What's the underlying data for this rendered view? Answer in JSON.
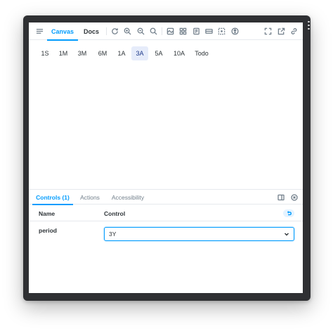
{
  "toolbar": {
    "tabs": [
      {
        "label": "Canvas",
        "active": true
      },
      {
        "label": "Docs",
        "active": false
      }
    ],
    "icons": [
      "sidebar-toggle-icon",
      "remount-icon",
      "zoom-in-icon",
      "zoom-out-icon",
      "zoom-reset-icon",
      "background-icon",
      "grid-icon",
      "viewport-icon",
      "measure-icon",
      "outline-icon",
      "accessibility-icon",
      "fullscreen-icon",
      "open-new-tab-icon",
      "copy-link-icon"
    ]
  },
  "canvas": {
    "periods": [
      {
        "label": "1S"
      },
      {
        "label": "1M"
      },
      {
        "label": "3M"
      },
      {
        "label": "6M"
      },
      {
        "label": "1A"
      },
      {
        "label": "3A",
        "selected": true
      },
      {
        "label": "5A"
      },
      {
        "label": "10A"
      },
      {
        "label": "Todo"
      }
    ]
  },
  "addons": {
    "tabs": [
      {
        "label": "Controls (1)",
        "active": true
      },
      {
        "label": "Actions",
        "active": false
      },
      {
        "label": "Accessibility",
        "active": false
      }
    ],
    "columns": {
      "name": "Name",
      "control": "Control"
    },
    "rows": [
      {
        "name": "period",
        "value": "3Y"
      }
    ]
  },
  "colors": {
    "accent": "#029cfd",
    "selected_bg": "#e6ecfa",
    "frame": "#2f3033"
  }
}
